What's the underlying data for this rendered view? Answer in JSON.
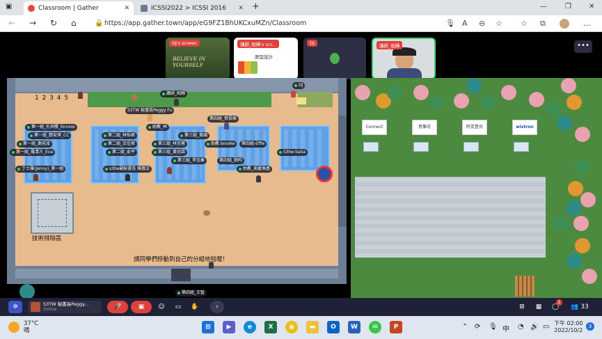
{
  "browser": {
    "tabs": [
      {
        "title": "Classroom | Gather",
        "active": true
      },
      {
        "title": "ICSSI2022 > ICSSI 2016",
        "active": false
      }
    ],
    "new_tab": "+",
    "url": "https://app.gather.town/app/eG9FZ1BhUKCxuMZn/Classroom"
  },
  "video_tiles": [
    {
      "label": "DJ's screen",
      "content": "BELIEVE IN YOURSELF"
    },
    {
      "label": "講師_昭輝's scr...",
      "content": "原型設計"
    },
    {
      "label": "DJ",
      "content": ""
    },
    {
      "label": "講師_昭輝",
      "content": ""
    }
  ],
  "map": {
    "numbers": "1 2 3 4 5",
    "sign_left": "技術排除區",
    "announcement": "請同學們移動到自己的分組地毯喔！",
    "name_tags": [
      {
        "text": "講師_昭輝",
        "color": "#36d46a"
      },
      {
        "text": "DJ",
        "color": "#36d46a"
      },
      {
        "text": "S3TW 秘書長Peggy Fu",
        "color": "#36d46a"
      },
      {
        "text": "第四組_張長榮",
        "color": "#36d46a"
      },
      {
        "text": "第一組_孔祥勝_Encore",
        "color": "#36d46a"
      },
      {
        "text": "第一組_鄭安琪_CC",
        "color": "#36d46a"
      },
      {
        "text": "第一組_謝宛凌",
        "color": "#36d46a"
      },
      {
        "text": "第一組_羅清方_Eva",
        "color": "#36d46a"
      },
      {
        "text": "丁士雅(Jenny)_第一組",
        "color": "#36d46a"
      },
      {
        "text": "第二組_林怡君",
        "color": "#36d46a"
      },
      {
        "text": "第二組_沈佳君",
        "color": "#36d46a"
      },
      {
        "text": "第二組_俞平",
        "color": "#36d46a"
      },
      {
        "text": "s3tw副秘書長 陳惠文",
        "color": "#36d46a"
      },
      {
        "text": "助教_林",
        "color": "#36d46a"
      },
      {
        "text": "第三組_黃國",
        "color": "#36d46a"
      },
      {
        "text": "第三組_林宜蓉",
        "color": "#36d46a"
      },
      {
        "text": "第三組_李宜秦",
        "color": "#36d46a"
      },
      {
        "text": "第三組_黃冠霖",
        "color": "#36d46a"
      },
      {
        "text": "助教 brooke",
        "color": "#36d46a"
      },
      {
        "text": "第四組-Effie",
        "color": "#36d46a"
      },
      {
        "text": "第四組_劉昀",
        "color": "#36d46a"
      },
      {
        "text": "助教_美麗漁基",
        "color": "#36d46a"
      },
      {
        "text": "S3tw-SaSa",
        "color": "#36d46a"
      },
      {
        "text": "第四組_王智",
        "color": "#36d46a"
      }
    ],
    "sponsors": [
      "Connect",
      "意像坊",
      "阿克登台",
      "wistron"
    ]
  },
  "toolbar": {
    "user_name": "S3TW 秘書長Peggy...",
    "user_status": "Online",
    "participant_count": "33",
    "notification_badge": "1"
  },
  "taskbar": {
    "temperature": "37°C",
    "weather": "晴",
    "time": "下午 02:00",
    "date": "2022/10/2",
    "apps": [
      {
        "name": "start",
        "color": "#1f6fd8"
      },
      {
        "name": "teams",
        "color": "#5b5fc7"
      },
      {
        "name": "edge",
        "color": "#0f8bd8"
      },
      {
        "name": "excel",
        "color": "#1d7044",
        "letter": "X"
      },
      {
        "name": "chrome",
        "color": "#e8c019"
      },
      {
        "name": "explorer",
        "color": "#f0c03a"
      },
      {
        "name": "outlook",
        "color": "#0a64c2",
        "letter": "O"
      },
      {
        "name": "word",
        "color": "#2b5fb8",
        "letter": "W"
      },
      {
        "name": "line",
        "color": "#35c64a"
      },
      {
        "name": "powerpoint",
        "color": "#c64421",
        "letter": "P"
      }
    ]
  }
}
